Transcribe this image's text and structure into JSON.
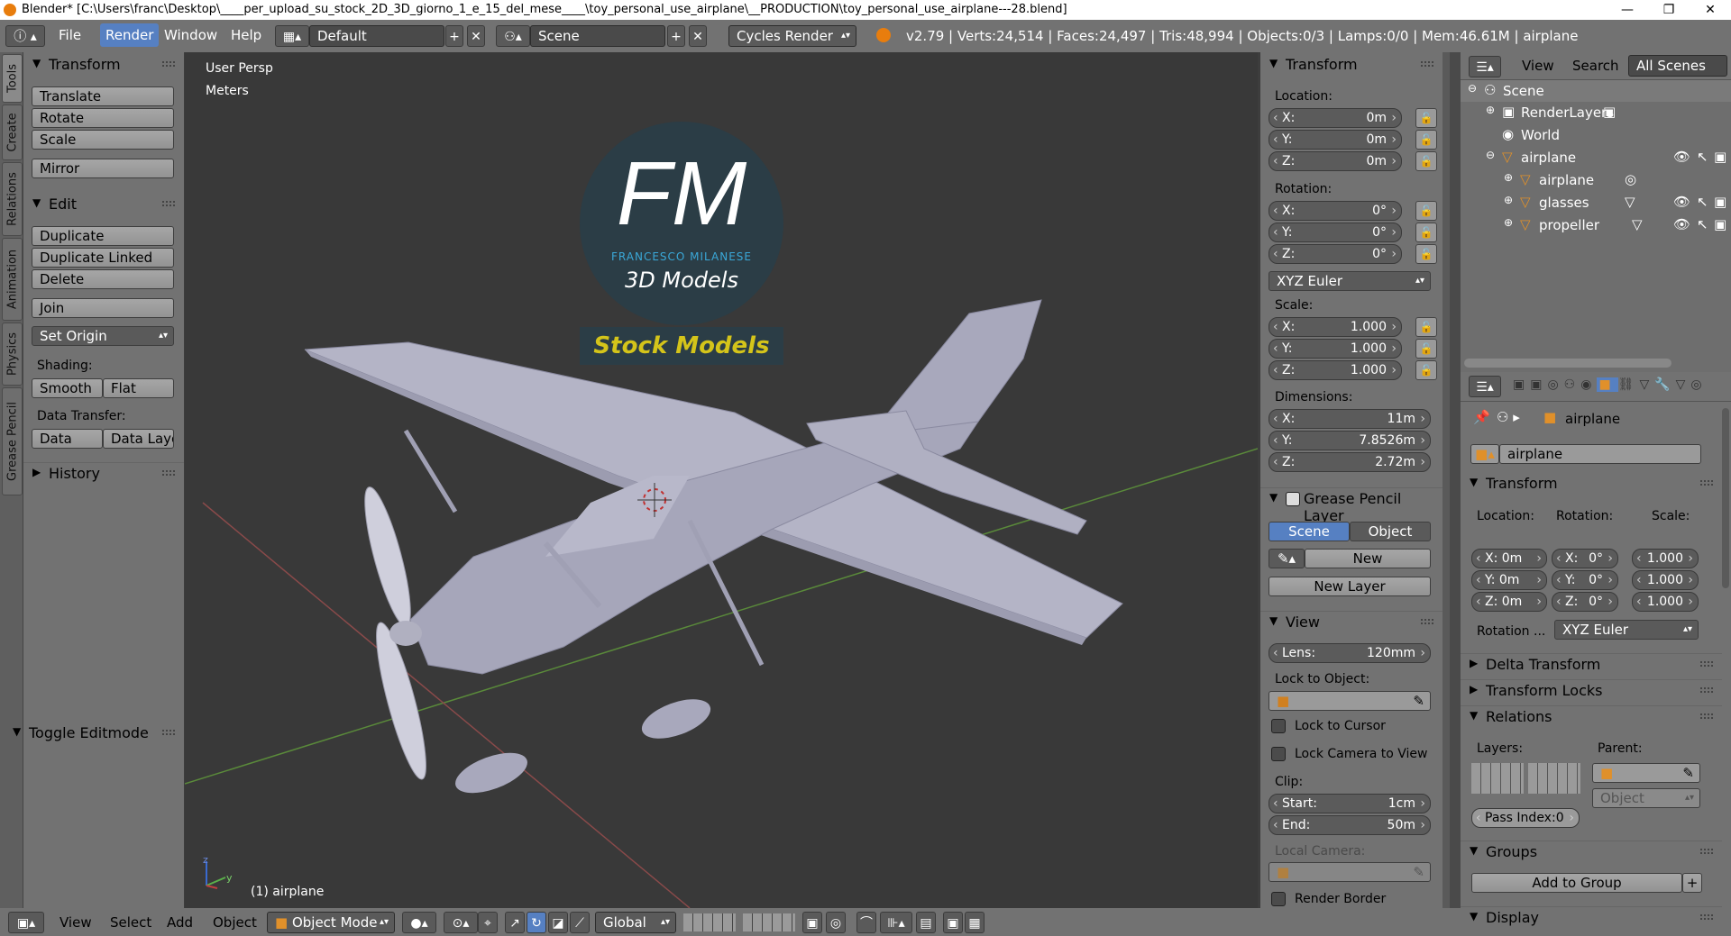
{
  "window": {
    "title": "Blender* [C:\\Users\\franc\\Desktop\\____per_upload_su_stock_2D_3D_giorno_1_e_15_del_mese____\\toy_personal_use_airplane\\__PRODUCTION\\toy_personal_use_airplane---28.blend]",
    "minimize": "—",
    "maximize": "❐",
    "close": "✕"
  },
  "topbar": {
    "menus": [
      "File",
      "Render",
      "Window",
      "Help"
    ],
    "layout": "Default",
    "scene": "Scene",
    "engine": "Cycles Render",
    "stats": "v2.79 | Verts:24,514 | Faces:24,497 | Tris:48,994 | Objects:0/3 | Lamps:0/0 | Mem:46.61M | airplane"
  },
  "tool_tabs": [
    "Tools",
    "Create",
    "Relations",
    "Animation",
    "Physics",
    "Grease Pencil"
  ],
  "toolshelf": {
    "transform_header": "Transform",
    "translate": "Translate",
    "rotate": "Rotate",
    "scale": "Scale",
    "mirror": "Mirror",
    "edit_header": "Edit",
    "duplicate": "Duplicate",
    "duplicate_linked": "Duplicate Linked",
    "delete": "Delete",
    "join": "Join",
    "set_origin": "Set Origin",
    "shading_label": "Shading:",
    "smooth": "Smooth",
    "flat": "Flat",
    "data_transfer_label": "Data Transfer:",
    "data": "Data",
    "data_layo": "Data Layo",
    "history": "History",
    "toggle_editmode": "Toggle Editmode"
  },
  "viewport": {
    "view_name": "User Persp",
    "units": "Meters",
    "object_label": "(1) airplane",
    "logo_fm": "FM",
    "logo_name": "FRANCESCO MILANESE",
    "logo_sub": "3D Models",
    "stock_badge": "Stock Models",
    "axis_z": "z",
    "axis_y": "y"
  },
  "npanel": {
    "transform_header": "Transform",
    "location_label": "Location:",
    "loc": [
      {
        "k": "X:",
        "v": "0m"
      },
      {
        "k": "Y:",
        "v": "0m"
      },
      {
        "k": "Z:",
        "v": "0m"
      }
    ],
    "rotation_label": "Rotation:",
    "rot": [
      {
        "k": "X:",
        "v": "0°"
      },
      {
        "k": "Y:",
        "v": "0°"
      },
      {
        "k": "Z:",
        "v": "0°"
      }
    ],
    "euler": "XYZ Euler",
    "scale_label": "Scale:",
    "scale": [
      {
        "k": "X:",
        "v": "1.000"
      },
      {
        "k": "Y:",
        "v": "1.000"
      },
      {
        "k": "Z:",
        "v": "1.000"
      }
    ],
    "dimensions_label": "Dimensions:",
    "dims": [
      {
        "k": "X:",
        "v": "11m"
      },
      {
        "k": "Y:",
        "v": "7.8526m"
      },
      {
        "k": "Z:",
        "v": "2.72m"
      }
    ],
    "grease_header": "Grease Pencil Layer",
    "scene_btn": "Scene",
    "object_btn": "Object",
    "new_btn": "New",
    "new_layer": "New Layer",
    "view_header": "View",
    "lens_k": "Lens:",
    "lens_v": "120mm",
    "lock_to_object": "Lock to Object:",
    "lock_cursor": "Lock to Cursor",
    "lock_camera": "Lock Camera to View",
    "clip_label": "Clip:",
    "start_k": "Start:",
    "start_v": "1cm",
    "end_k": "End:",
    "end_v": "50m",
    "local_camera": "Local Camera:",
    "render_border": "Render Border"
  },
  "outliner": {
    "view": "View",
    "search": "Search",
    "all_scenes": "All Scenes",
    "rows": [
      "Scene",
      "RenderLayers",
      "World",
      "airplane",
      "airplane",
      "glasses",
      "propeller"
    ]
  },
  "properties": {
    "object_path": "airplane",
    "object_name": "airplane",
    "transform_header": "Transform",
    "location": "Location:",
    "rotation": "Rotation:",
    "scale": "Scale:",
    "loc": [
      "X: 0m",
      "Y: 0m",
      "Z: 0m"
    ],
    "rot": [
      {
        "k": "X:",
        "v": "0°"
      },
      {
        "k": "Y:",
        "v": "0°"
      },
      {
        "k": "Z:",
        "v": "0°"
      }
    ],
    "scl": [
      "1.000",
      "1.000",
      "1.000"
    ],
    "rotation_mode_label": "Rotation ...",
    "rotation_mode": "XYZ Euler",
    "delta_transform": "Delta Transform",
    "transform_locks": "Transform Locks",
    "relations": "Relations",
    "layers": "Layers:",
    "parent": "Parent:",
    "parent_type": "Object",
    "pass_index": "Pass Index:0",
    "groups": "Groups",
    "add_to_group": "Add to Group",
    "display": "Display"
  },
  "bottombar": {
    "menus": [
      "View",
      "Select",
      "Add",
      "Object"
    ],
    "mode": "Object Mode",
    "orientation": "Global"
  }
}
